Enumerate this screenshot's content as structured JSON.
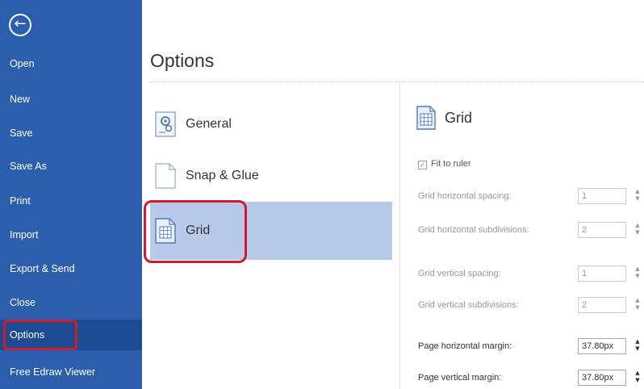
{
  "sidebar": {
    "back_icon": "arrow-left-circle-icon",
    "items": [
      {
        "label": "Open"
      },
      {
        "label": "New"
      },
      {
        "label": "Save"
      },
      {
        "label": "Save As"
      },
      {
        "label": "Print"
      },
      {
        "label": "Import"
      },
      {
        "label": "Export & Send"
      },
      {
        "label": "Close"
      },
      {
        "label": "Options",
        "selected": true
      },
      {
        "label": "Free Edraw Viewer"
      }
    ],
    "background": "#2b5fad",
    "selected_background": "#1c4b94"
  },
  "main": {
    "title": "Options",
    "categories": [
      {
        "label": "General",
        "icon": "general-settings-icon"
      },
      {
        "label": "Snap & Glue",
        "icon": "blank-page-icon"
      },
      {
        "label": "Grid",
        "icon": "grid-document-icon",
        "selected": true
      }
    ],
    "selected_category_background": "#b8c9e9",
    "highlight_color": "#d11a2a"
  },
  "grid_panel": {
    "title": "Grid",
    "icon": "grid-document-icon",
    "fit_to_ruler": {
      "label": "Fit to ruler",
      "checked": true
    },
    "fields": [
      {
        "label": "Grid horizontal spacing:",
        "value": "1",
        "enabled": false
      },
      {
        "label": "Grid horizontal subdivisions:",
        "value": "2",
        "enabled": false
      },
      {
        "label": "Grid vertical spacing:",
        "value": "1",
        "enabled": false
      },
      {
        "label": "Grid vertical subdivisions:",
        "value": "2",
        "enabled": false
      },
      {
        "label": "Page horizontal margin:",
        "value": "37.80px",
        "enabled": true
      },
      {
        "label": "Page vertical margin:",
        "value": "37.80px",
        "enabled": true
      }
    ]
  }
}
